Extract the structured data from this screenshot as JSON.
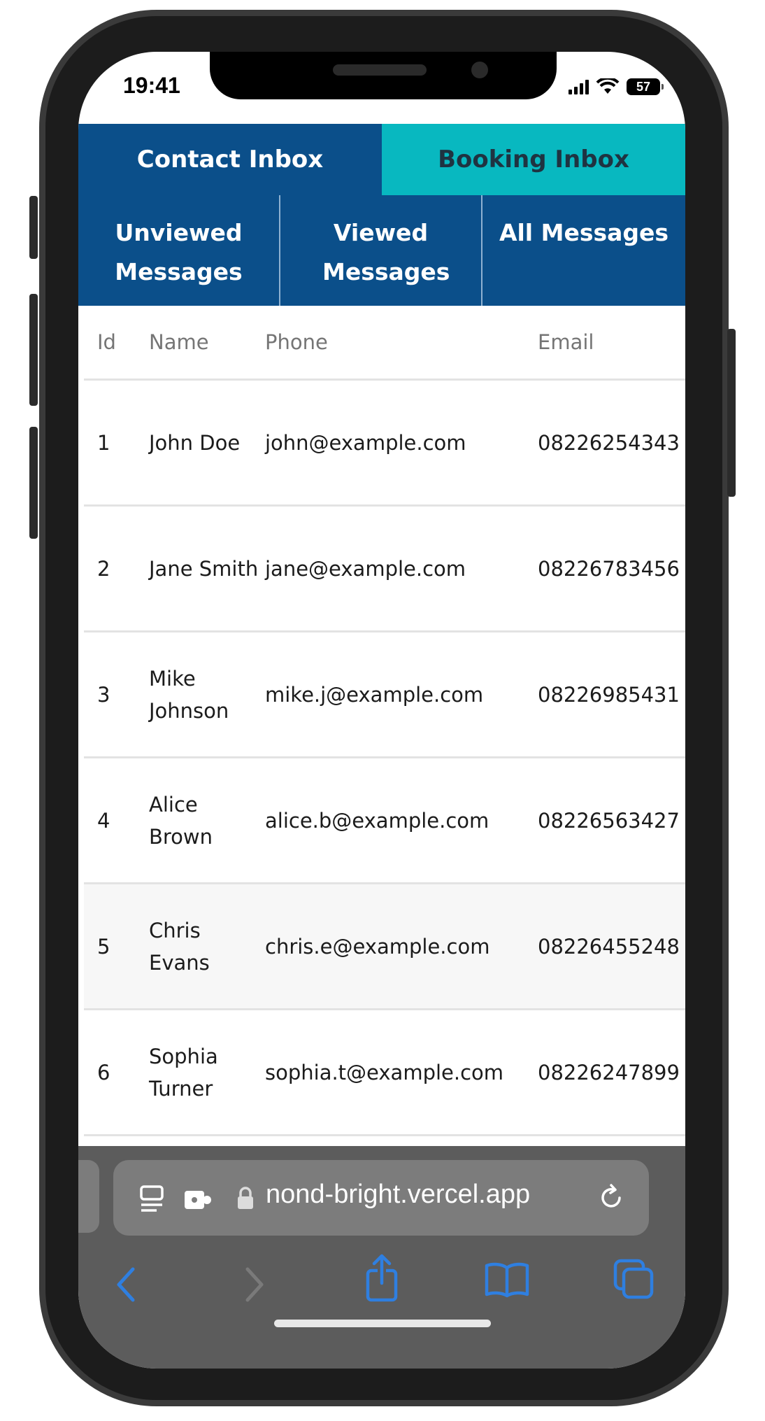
{
  "status": {
    "time": "19:41",
    "battery": "57"
  },
  "tabs": [
    {
      "label": "Contact Inbox"
    },
    {
      "label": "Booking Inbox"
    }
  ],
  "filters": [
    {
      "label": "Unviewed Messages"
    },
    {
      "label": "Viewed Messages"
    },
    {
      "label": "All Messages"
    }
  ],
  "table": {
    "headers": [
      "Id",
      "Name",
      "Phone",
      "Email"
    ],
    "rows": [
      {
        "id": "1",
        "name": "John Doe",
        "email": "john@example.com",
        "phone": "08226254343"
      },
      {
        "id": "2",
        "name": "Jane Smith",
        "email": "jane@example.com",
        "phone": "08226783456"
      },
      {
        "id": "3",
        "name": "Mike Johnson",
        "email": "mike.j@example.com",
        "phone": "08226985431"
      },
      {
        "id": "4",
        "name": "Alice Brown",
        "email": "alice.b@example.com",
        "phone": "08226563427"
      },
      {
        "id": "5",
        "name": "Chris Evans",
        "email": "chris.e@example.com",
        "phone": "08226455248"
      },
      {
        "id": "6",
        "name": "Sophia Turner",
        "email": "sophia.t@example.com",
        "phone": "08226247899"
      }
    ]
  },
  "browser": {
    "url": "nond-bright.vercel.app"
  },
  "colors": {
    "primary": "#0b4f8a",
    "accent": "#08b8c0",
    "safari_blue": "#2f7fe0"
  }
}
